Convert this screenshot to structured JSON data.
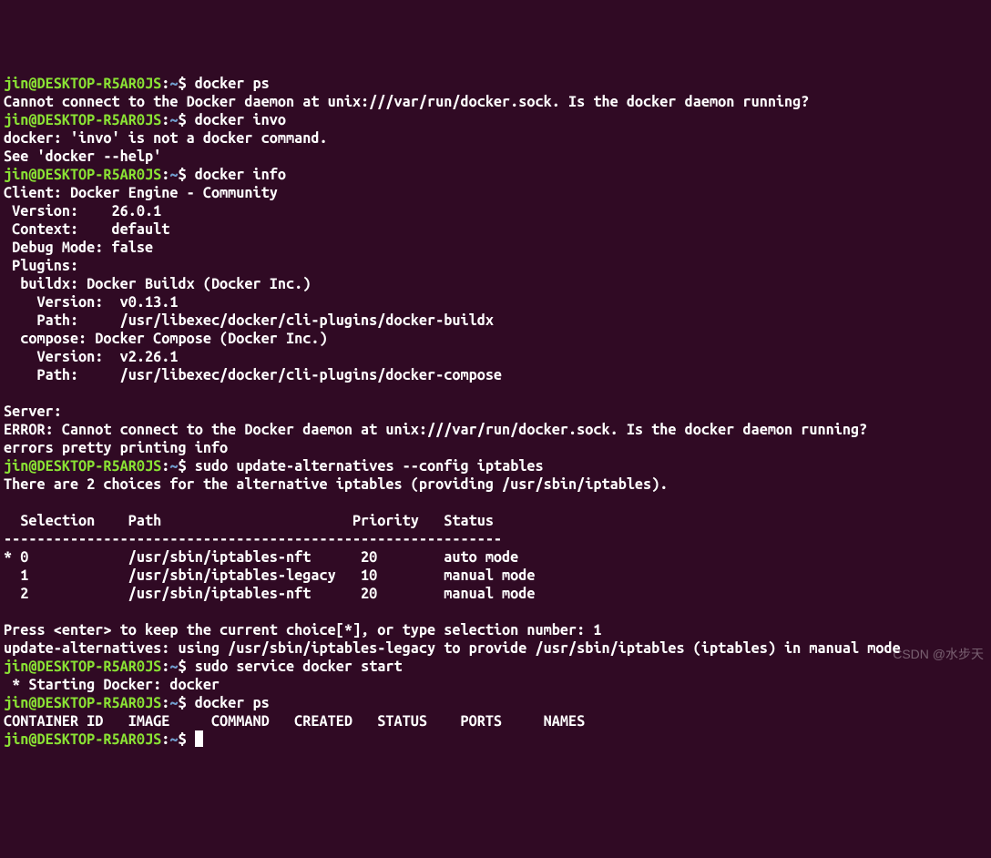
{
  "prompt": {
    "user": "jin@DESKTOP-R5AR0JS",
    "tilde": "~",
    "dollar": "$"
  },
  "blocks": [
    {
      "cmd": "docker ps",
      "out": [
        "Cannot connect to the Docker daemon at unix:///var/run/docker.sock. Is the docker daemon running?"
      ]
    },
    {
      "cmd": "docker invo",
      "out": [
        "docker: 'invo' is not a docker command.",
        "See 'docker --help'"
      ]
    },
    {
      "cmd": "docker info",
      "out": [
        "Client: Docker Engine - Community",
        " Version:    26.0.1",
        " Context:    default",
        " Debug Mode: false",
        " Plugins:",
        "  buildx: Docker Buildx (Docker Inc.)",
        "    Version:  v0.13.1",
        "    Path:     /usr/libexec/docker/cli-plugins/docker-buildx",
        "  compose: Docker Compose (Docker Inc.)",
        "    Version:  v2.26.1",
        "    Path:     /usr/libexec/docker/cli-plugins/docker-compose",
        "",
        "Server:",
        "ERROR: Cannot connect to the Docker daemon at unix:///var/run/docker.sock. Is the docker daemon running?",
        "errors pretty printing info"
      ]
    },
    {
      "cmd": "sudo update-alternatives --config iptables",
      "out": [
        "There are 2 choices for the alternative iptables (providing /usr/sbin/iptables).",
        "",
        "  Selection    Path                       Priority   Status",
        "------------------------------------------------------------",
        "* 0            /usr/sbin/iptables-nft      20        auto mode",
        "  1            /usr/sbin/iptables-legacy   10        manual mode",
        "  2            /usr/sbin/iptables-nft      20        manual mode",
        "",
        "Press <enter> to keep the current choice[*], or type selection number: 1",
        "update-alternatives: using /usr/sbin/iptables-legacy to provide /usr/sbin/iptables (iptables) in manual mode"
      ]
    },
    {
      "cmd": "sudo service docker start",
      "out": [
        " * Starting Docker: docker"
      ]
    },
    {
      "cmd": "docker ps",
      "out": [
        "CONTAINER ID   IMAGE     COMMAND   CREATED   STATUS    PORTS     NAMES"
      ]
    },
    {
      "cmd": "",
      "out": [],
      "cursor": true
    }
  ],
  "watermark": "CSDN @水步天"
}
